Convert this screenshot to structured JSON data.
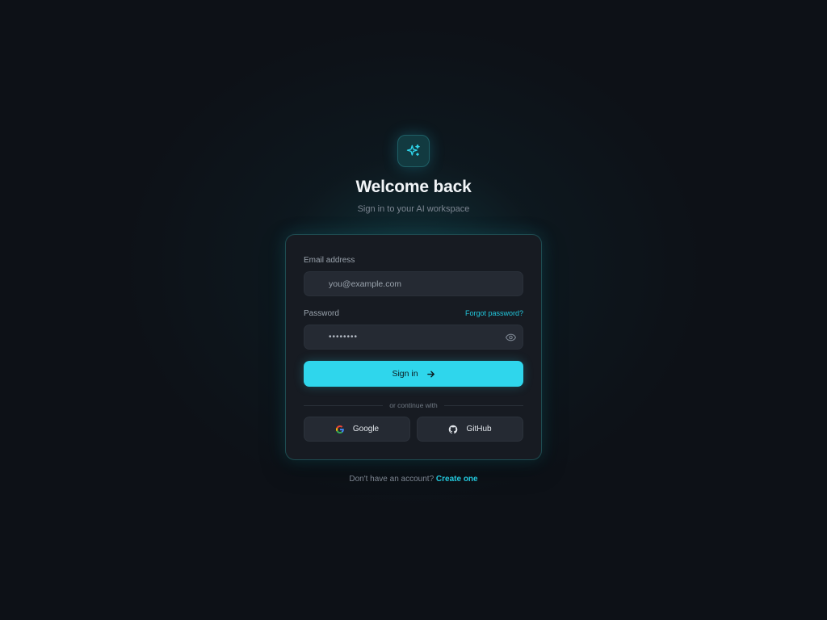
{
  "app": {
    "title": "Welcome back",
    "subtitle": "Sign in to your AI workspace",
    "logo_icon": "sparkles-icon",
    "accent_color": "#2fd6ec"
  },
  "form": {
    "email_label": "Email address",
    "email_placeholder": "you@example.com",
    "password_label": "Password",
    "password_value": "••••••••",
    "forgot_label": "Forgot password?",
    "submit_label": "Sign in",
    "submit_icon": "arrow-right-icon",
    "toggle_visibility_icon": "eye-icon"
  },
  "social": {
    "divider_text": "or continue with",
    "google_label": "Google",
    "github_label": "GitHub"
  },
  "footer": {
    "prompt": "Don't have an account?",
    "link": "Create one"
  }
}
